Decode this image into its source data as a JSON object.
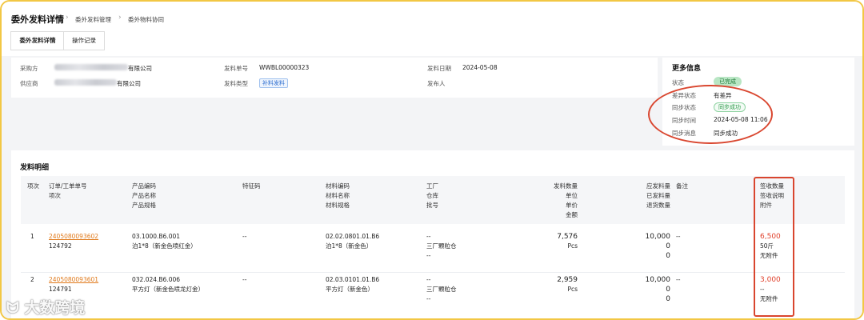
{
  "header": {
    "title": "委外发料详情",
    "breadcrumb": [
      "委外发料管理",
      "委外物料协同"
    ],
    "tabs": [
      {
        "label": "委外发料详情",
        "active": true
      },
      {
        "label": "操作记录",
        "active": false
      }
    ]
  },
  "info": {
    "purchaser_label": "采购方",
    "purchaser_suffix": "有限公司",
    "supplier_label": "供应商",
    "supplier_suffix": "有限公司",
    "issue_no_label": "发料单号",
    "issue_no": "WWBL00000323",
    "issue_type_label": "发料类型",
    "issue_type": "补料发料",
    "issue_date_label": "发料日期",
    "issue_date": "2024-05-08",
    "publisher_label": "发布人",
    "publisher": ""
  },
  "more_info": {
    "title": "更多信息",
    "status_label": "状态",
    "status": "已完成",
    "diff_label": "差异状态",
    "diff": "有差异",
    "sync_label": "同步状态",
    "sync": "同步成功",
    "sync_time_label": "同步时间",
    "sync_time": "2024-05-08 11:06",
    "sync_msg_label": "同步消息",
    "sync_msg": "同步成功"
  },
  "detail": {
    "title": "发料明细",
    "headers": {
      "seq": "项次",
      "order": [
        "订单/工单单号",
        "项次"
      ],
      "product": [
        "产品编码",
        "产品名称",
        "产品规格"
      ],
      "feature": "特征码",
      "material": [
        "材料编码",
        "材料名称",
        "材料规格"
      ],
      "factory": [
        "工厂",
        "仓库",
        "批号"
      ],
      "issue_qty": [
        "发料数量",
        "单位",
        "单价",
        "金额"
      ],
      "should_qty": [
        "应发料量",
        "已发料量",
        "退货数量"
      ],
      "remark": "备注",
      "receipt": [
        "签收数量",
        "签收说明",
        "附件"
      ]
    },
    "rows": [
      {
        "seq": "1",
        "order_no": "2405080093602",
        "order_item": "124792",
        "product_code": "03.1000.B6.001",
        "product_name": "泊1*8（新金色喷红金）",
        "feature": "--",
        "material_code": "02.02.0801.01.B6",
        "material_name": "泊1*8（新金色）",
        "factory": "--",
        "warehouse": "三厂颗粒仓",
        "batch": "--",
        "issue_qty": "7,576",
        "unit": "Pcs",
        "should_qty": "10,000",
        "issued_qty": "0",
        "return_qty": "0",
        "remark": "--",
        "receipt_qty": "6,500",
        "receipt_note": "50斤",
        "attachment": "无附件"
      },
      {
        "seq": "2",
        "order_no": "2405080093601",
        "order_item": "124791",
        "product_code": "032.024.B6.006",
        "product_name": "平方灯（新金色喷龙灯金）",
        "feature": "--",
        "material_code": "02.03.0101.01.B6",
        "material_name": "平方灯（新金色）",
        "factory": "--",
        "warehouse": "三厂颗粒仓",
        "batch": "--",
        "issue_qty": "2,959",
        "unit": "Pcs",
        "should_qty": "10,000",
        "issued_qty": "0",
        "return_qty": "0",
        "remark": "--",
        "receipt_qty": "3,000",
        "receipt_note": "--",
        "attachment": "无附件"
      }
    ]
  },
  "watermark": "大数跨境",
  "colors": {
    "frame": "#f2c744",
    "link": "#e07a1c",
    "highlight": "#d9462f",
    "success": "#2d9b4a"
  }
}
